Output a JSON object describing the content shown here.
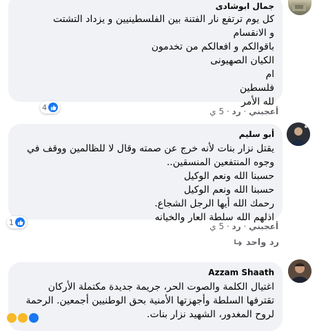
{
  "comments": [
    {
      "author": "جمال ابوشادى",
      "lines": [
        "كل يوم ترتفع نار الفتنة بين الفلسطينيين و يزداد التشتت",
        "و الانقسام",
        "باقوالكم و افعالكم من تخدمون",
        "الكيان الصهيونى",
        "ام",
        "فلسطين",
        "لله الأمر"
      ],
      "like": "أعجبني",
      "reply": "رد",
      "time": "5 ي",
      "reactions": "4"
    },
    {
      "author": "أبو سليم",
      "lines": [
        "يقتل نزار بنات لأنه خرج عن صمته وقال لا للظالمين ووقف في",
        "وجوه المنتفعين المنسقين..",
        "حسبنا الله ونعم الوكيل",
        "حسبنا الله ونعم الوكيل",
        "رحمك الله أيها الرجل الشجاع.",
        "اذلهم الله سلطة العار والخيانه"
      ],
      "like": "أعجبني",
      "reply": "رد",
      "time": "5 ي",
      "reactions": "1",
      "replies_link": "رد واحد"
    },
    {
      "author": "Azzam Shaath",
      "lines": [
        "اغتيال الكلمة والصوت الحر، جريمة جديدة مكتملة الأركان",
        "تقترفها السلطة وأجهزتها الأمنية بحق الوطنيين أجمعين. الرحمة",
        "لروح المغدور، الشهيد نزار بنات."
      ]
    }
  ],
  "colors": {
    "bubble": "#f0f2f5",
    "meta": "#65676b",
    "like_badge": "#1877f2"
  }
}
